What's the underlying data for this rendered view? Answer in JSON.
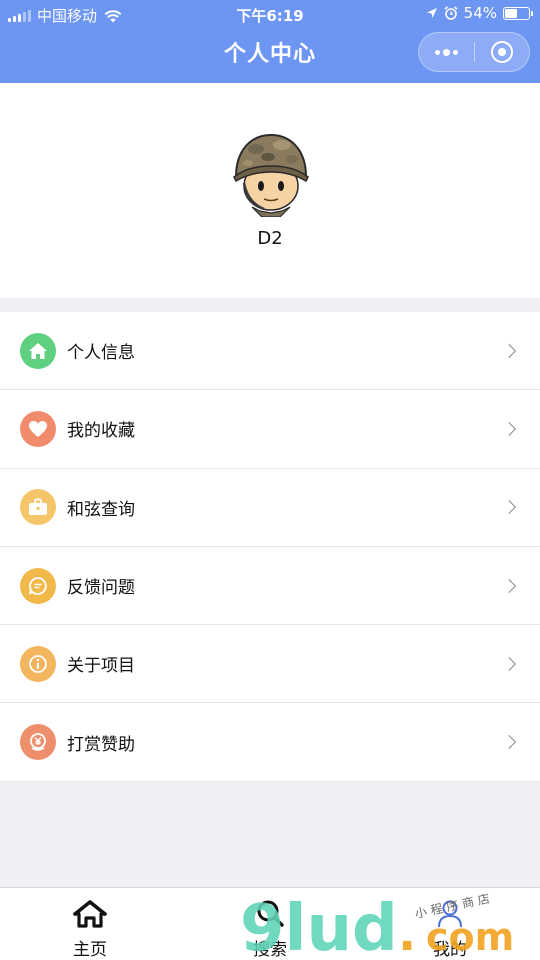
{
  "status_bar": {
    "carrier": "中国移动",
    "time": "下午6:19",
    "battery_percent": "54%",
    "battery_level": 0.54
  },
  "nav": {
    "title": "个人中心",
    "capsule_menu_icon": "more-dots-icon",
    "capsule_close_icon": "close-target-icon"
  },
  "profile": {
    "username": "D2",
    "avatar_icon": "soldier-avatar-icon"
  },
  "menu": {
    "items": [
      {
        "label": "个人信息",
        "icon": "home-icon",
        "color": "#5fcf80"
      },
      {
        "label": "我的收藏",
        "icon": "heart-icon",
        "color": "#f08c6c"
      },
      {
        "label": "和弦查询",
        "icon": "briefcase-icon",
        "color": "#f5c56a"
      },
      {
        "label": "反馈问题",
        "icon": "chat-bubble-icon",
        "color": "#f0b94a"
      },
      {
        "label": "关于项目",
        "icon": "info-icon",
        "color": "#f3b65e"
      },
      {
        "label": "打赏赞助",
        "icon": "reward-icon",
        "color": "#ee8f6b"
      }
    ]
  },
  "tabbar": {
    "tabs": [
      {
        "label": "主页",
        "icon": "home-icon"
      },
      {
        "label": "搜索",
        "icon": "search-icon"
      },
      {
        "label": "我的",
        "icon": "user-icon"
      }
    ]
  },
  "watermark": {
    "text_main": "9lud",
    "text_dot": ".",
    "text_com": "com",
    "text_small": "小程序商店"
  },
  "colors": {
    "nav_bg": "#6d95f2",
    "page_bg": "#efeff4"
  }
}
